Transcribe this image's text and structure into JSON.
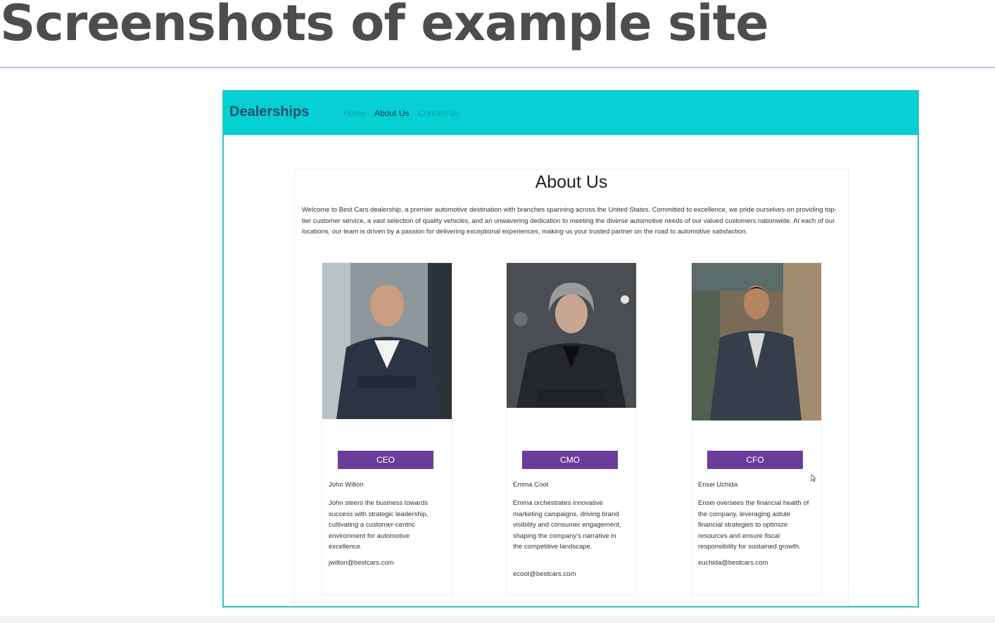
{
  "slide": {
    "title": "Screenshots of example site"
  },
  "site": {
    "navbar": {
      "brand": "Dealerships",
      "links": [
        {
          "label": "Home",
          "active": false
        },
        {
          "label": "About Us",
          "active": true
        },
        {
          "label": "Contact Us",
          "active": false
        }
      ]
    },
    "about": {
      "title": "About Us",
      "intro": "Welcome to Best Cars dealership, a premier automotive destination with branches spanning across the United States. Committed to excellence, we pride ourselves on providing top-tier customer service, a vast selection of quality vehicles, and an unwavering dedication to meeting the diverse automotive needs of our valued customers nationwide. At each of our locations, our team is driven by a passion for delivering exceptional experiences, making us your trusted partner on the road to automotive satisfaction.",
      "team": [
        {
          "role": "CEO",
          "name": "John Wilton",
          "bio": "John steers the business towards success with strategic leadership, cultivating a customer-centric environment for automotive excellence.",
          "email": "jwilton@bestcars.com"
        },
        {
          "role": "CMO",
          "name": "Emma Coot",
          "bio": "Emma orchestrates innovative marketing campaigns, driving brand visibility and consumer engagement, shaping the company's narrative in the competitive landscape.",
          "email": "ecoot@bestcars.com"
        },
        {
          "role": "CFO",
          "name": "Ensei Uchida",
          "bio": "Ensei oversees the financial health of the company, leveraging astute financial strategies to optimize resources and ensure fiscal responsibility for sustained growth.",
          "email": "euchida@bestcars.com"
        }
      ]
    }
  },
  "colors": {
    "navbar": "#05d0d3",
    "frame_border": "#34c3c6",
    "role_badge": "#6a3d9a",
    "title_text": "#4d4d4d"
  }
}
